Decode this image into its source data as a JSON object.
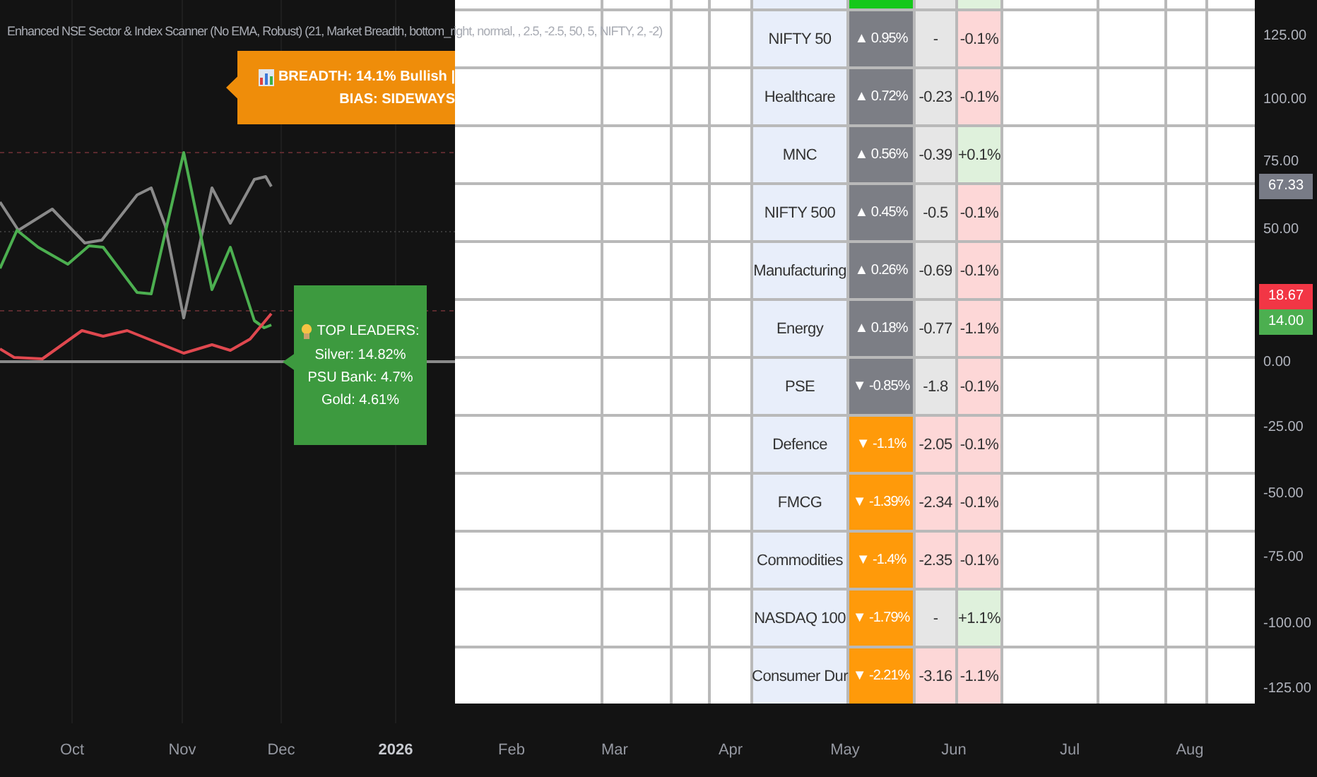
{
  "title": "Enhanced NSE Sector & Index Scanner (No EMA, Robust) (21, Market Breadth, bottom_right, normal, , 2.5, -2.5, 50, 5, NIFTY, 2, -2)",
  "breadth_label": {
    "lines": [
      "BREADTH: 14.1% Bullish |",
      "BIAS: SIDEWAYS"
    ]
  },
  "leaders_label": {
    "heading": "TOP LEADERS:",
    "lines": [
      "Silver: 14.82%",
      "PSU Bank: 4.7%",
      "Gold: 4.61%"
    ]
  },
  "table": {
    "partial_top_row": {
      "cells": [
        {
          "color": "#15c81a"
        },
        {
          "color": "#e6e6e6"
        },
        {
          "color": "#dff1dc"
        }
      ]
    },
    "rows": [
      {
        "name": "NIFTY 50",
        "cells": [
          {
            "text": "▲ 0.95%",
            "color": "#7c7e85"
          },
          {
            "text": "-",
            "color": "#e6e6e6"
          },
          {
            "text": "-0.1%",
            "color": "#fdd7d7"
          }
        ]
      },
      {
        "name": "Healthcare",
        "cells": [
          {
            "text": "▲ 0.72%",
            "color": "#7c7e85"
          },
          {
            "text": "-0.23",
            "color": "#e6e6e6"
          },
          {
            "text": "-0.1%",
            "color": "#fdd7d7"
          }
        ]
      },
      {
        "name": "MNC",
        "cells": [
          {
            "text": "▲ 0.56%",
            "color": "#7c7e85"
          },
          {
            "text": "-0.39",
            "color": "#e6e6e6"
          },
          {
            "text": "+0.1%",
            "color": "#dff1dc"
          }
        ]
      },
      {
        "name": "NIFTY 500",
        "cells": [
          {
            "text": "▲ 0.45%",
            "color": "#7c7e85"
          },
          {
            "text": "-0.5",
            "color": "#e6e6e6"
          },
          {
            "text": "-0.1%",
            "color": "#fdd7d7"
          }
        ]
      },
      {
        "name": "Manufacturing",
        "cells": [
          {
            "text": "▲ 0.26%",
            "color": "#7c7e85"
          },
          {
            "text": "-0.69",
            "color": "#e6e6e6"
          },
          {
            "text": "-0.1%",
            "color": "#fdd7d7"
          }
        ]
      },
      {
        "name": "Energy",
        "cells": [
          {
            "text": "▲ 0.18%",
            "color": "#7c7e85"
          },
          {
            "text": "-0.77",
            "color": "#e6e6e6"
          },
          {
            "text": "-1.1%",
            "color": "#fdd7d7"
          }
        ]
      },
      {
        "name": "PSE",
        "cells": [
          {
            "text": "▼ -0.85%",
            "color": "#7c7e85"
          },
          {
            "text": "-1.8",
            "color": "#e6e6e6"
          },
          {
            "text": "-0.1%",
            "color": "#fdd7d7"
          }
        ]
      },
      {
        "name": "Defence",
        "cells": [
          {
            "text": "▼ -1.1%",
            "color": "#ff9a0a"
          },
          {
            "text": "-2.05",
            "color": "#fdd7d7"
          },
          {
            "text": "-0.1%",
            "color": "#fdd7d7"
          }
        ]
      },
      {
        "name": "FMCG",
        "cells": [
          {
            "text": "▼ -1.39%",
            "color": "#ff9a0a"
          },
          {
            "text": "-2.34",
            "color": "#fdd7d7"
          },
          {
            "text": "-0.1%",
            "color": "#fdd7d7"
          }
        ]
      },
      {
        "name": "Commodities",
        "cells": [
          {
            "text": "▼ -1.4%",
            "color": "#ff9a0a"
          },
          {
            "text": "-2.35",
            "color": "#fdd7d7"
          },
          {
            "text": "-0.1%",
            "color": "#fdd7d7"
          }
        ]
      },
      {
        "name": "NASDAQ 100",
        "cells": [
          {
            "text": "▼ -1.79%",
            "color": "#ff9a0a"
          },
          {
            "text": "-",
            "color": "#e6e6e6"
          },
          {
            "text": "+1.1%",
            "color": "#dff1dc"
          }
        ]
      },
      {
        "name": "Consumer Dur",
        "cells": [
          {
            "text": "▼ -2.21%",
            "color": "#ff9a0a"
          },
          {
            "text": "-3.16",
            "color": "#fdd7d7"
          },
          {
            "text": "-1.1%",
            "color": "#fdd7d7"
          }
        ]
      }
    ]
  },
  "price_axis": {
    "ticks": [
      "125.00",
      "100.00",
      "75.00",
      "50.00",
      "0.00",
      "-25.00",
      "-50.00",
      "-75.00",
      "-100.00",
      "-125.00"
    ],
    "badges": [
      {
        "text": "67.33",
        "color": "#787b86"
      },
      {
        "text": "18.67",
        "color": "#f23645"
      },
      {
        "text": "14.00",
        "color": "#4caf50"
      }
    ]
  },
  "time_axis": {
    "labels": [
      {
        "text": "Oct",
        "kind": "month"
      },
      {
        "text": "Nov",
        "kind": "month"
      },
      {
        "text": "Dec",
        "kind": "month"
      },
      {
        "text": "2026",
        "kind": "year"
      },
      {
        "text": "Feb",
        "kind": "month"
      },
      {
        "text": "Mar",
        "kind": "month"
      },
      {
        "text": "Apr",
        "kind": "month"
      },
      {
        "text": "May",
        "kind": "month"
      },
      {
        "text": "Jun",
        "kind": "month"
      },
      {
        "text": "Jul",
        "kind": "month"
      },
      {
        "text": "Aug",
        "kind": "month"
      }
    ]
  }
}
